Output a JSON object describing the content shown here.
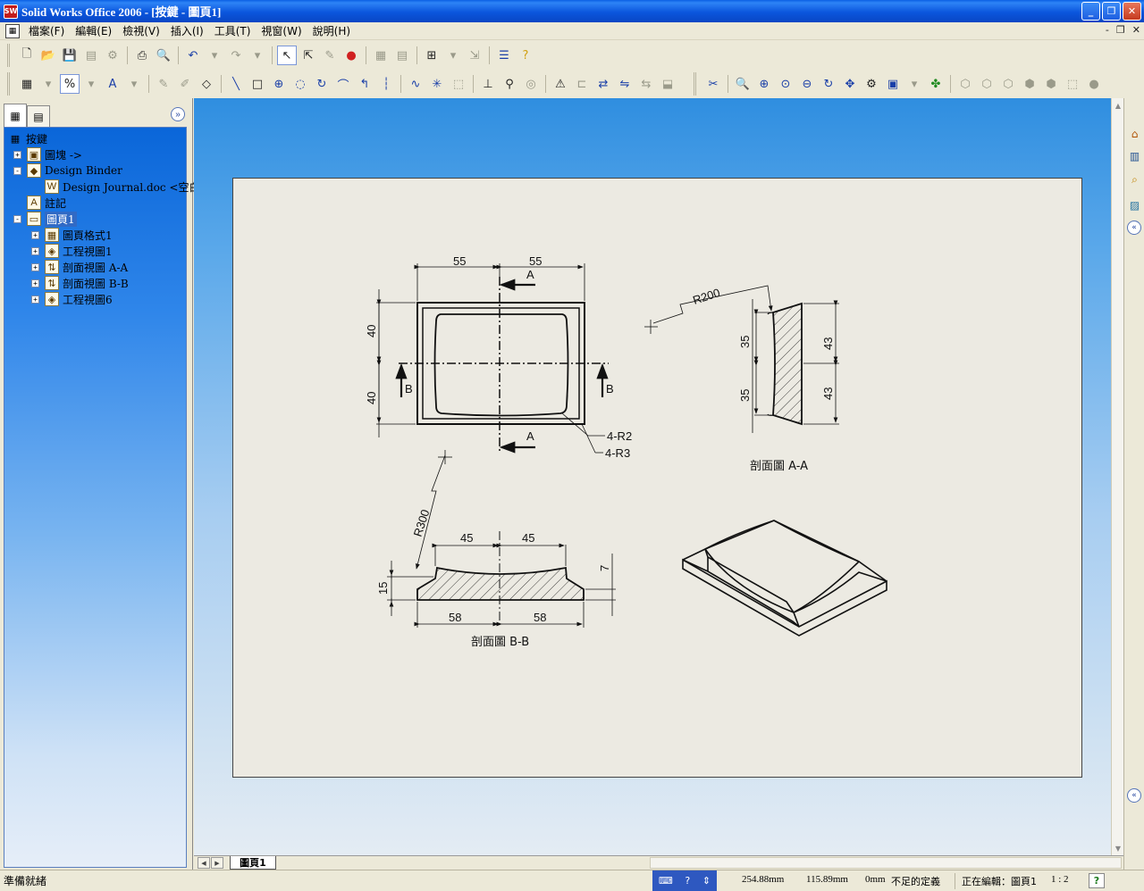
{
  "window": {
    "title": "Solid Works Office 2006 - [按鍵 - 圖頁1]",
    "app_icon": "SW",
    "minimize_label": "_",
    "restore_label": "❐",
    "close_label": "✕"
  },
  "menu": {
    "items": [
      "檔案(F)",
      "編輯(E)",
      "檢視(V)",
      "插入(I)",
      "工具(T)",
      "視窗(W)",
      "說明(H)"
    ],
    "mdi_buttons": [
      "-",
      "❐",
      "✕"
    ]
  },
  "toolbars": {
    "row1_icons": [
      "new-icon",
      "open-icon",
      "save-icon",
      "print-preview-icon",
      "options-icon",
      "print-icon",
      "preview-icon",
      "undo-icon",
      "redo-icon",
      "select-icon",
      "select-filter-icon",
      "sketch-icon",
      "rebuild-icon",
      "grid-icon",
      "layers-icon",
      "annotation-icon",
      "smart-dim-icon",
      "properties-icon",
      "help-icon"
    ],
    "row2_icons": [
      "note-icon",
      "dimension-icon",
      "font-icon",
      "line-icon",
      "rectangle-icon",
      "circle-icon",
      "arc-icon",
      "spline-icon",
      "zoom-fit-icon",
      "zoom-area-icon",
      "zoom-in-icon",
      "zoom-out-icon",
      "rotate-icon",
      "pan-icon",
      "view-orient-icon",
      "display-icon",
      "measure-icon"
    ]
  },
  "tree": {
    "root": "按鍵",
    "items": [
      {
        "label": "圖塊 ->",
        "toggle": "+",
        "icon": "▣",
        "indent": 1
      },
      {
        "label": "Design Binder",
        "toggle": "-",
        "icon": "◆",
        "indent": 1
      },
      {
        "label": "Design Journal.doc <空白>",
        "toggle": "",
        "icon": "W",
        "indent": 2
      },
      {
        "label": "註記",
        "toggle": "",
        "icon": "A",
        "indent": 1
      },
      {
        "label": "圖頁1",
        "toggle": "-",
        "icon": "▭",
        "indent": 1,
        "selected": true
      },
      {
        "label": "圖頁格式1",
        "toggle": "+",
        "icon": "▦",
        "indent": 2
      },
      {
        "label": "工程視圖1",
        "toggle": "+",
        "icon": "◈",
        "indent": 2
      },
      {
        "label": "剖面視圖 A-A",
        "toggle": "+",
        "icon": "⇅",
        "indent": 2
      },
      {
        "label": "剖面視圖 B-B",
        "toggle": "+",
        "icon": "⇅",
        "indent": 2
      },
      {
        "label": "工程視圖6",
        "toggle": "+",
        "icon": "◈",
        "indent": 2
      }
    ],
    "expand_icon": "»"
  },
  "drawing": {
    "top_view": {
      "dim_top_left": "55",
      "dim_top_right": "55",
      "dim_left_top": "40",
      "dim_left_bottom": "40",
      "section_a": "A",
      "section_b": "B",
      "radius_note_1": "4-R2",
      "radius_note_2": "4-R3"
    },
    "section_aa": {
      "radius": "R200",
      "dim_left_top": "35",
      "dim_left_bottom": "35",
      "dim_right_top": "43",
      "dim_right_bottom": "43",
      "label": "剖面圖 A-A"
    },
    "section_bb": {
      "radius": "R300",
      "dim_top_left": "45",
      "dim_top_right": "45",
      "dim_bottom_left": "58",
      "dim_bottom_right": "58",
      "dim_height": "15",
      "dim_depth": "7",
      "label": "剖面圖 B-B"
    }
  },
  "sheet_tabs": {
    "active": "圖頁1"
  },
  "status": {
    "ready": "準備就緒",
    "x": "254.88mm",
    "y": "115.89mm",
    "z": "0mm",
    "definition": "不足的定義",
    "editing": "正在編輯：圖頁1",
    "scale": "1 : 2",
    "help": "?"
  }
}
